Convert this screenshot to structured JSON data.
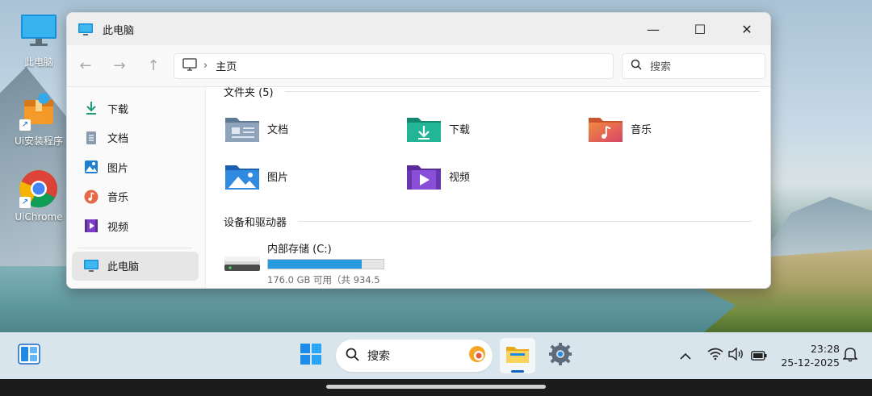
{
  "desktop": {
    "icons": [
      {
        "label": "此电脑"
      },
      {
        "label": "Ui安装程序"
      },
      {
        "label": "UiChrome"
      }
    ]
  },
  "window": {
    "title": "此电脑",
    "controls": {
      "minimize": "—",
      "maximize": "☐",
      "close": "✕"
    },
    "address": {
      "location": "主页",
      "separator": "›"
    },
    "search_placeholder": "搜索",
    "sidebar": {
      "items": [
        {
          "label": "下载",
          "icon": "download-icon"
        },
        {
          "label": "文档",
          "icon": "document-icon"
        },
        {
          "label": "图片",
          "icon": "pictures-icon"
        },
        {
          "label": "音乐",
          "icon": "music-icon"
        },
        {
          "label": "视频",
          "icon": "video-icon"
        }
      ],
      "active_item": {
        "label": "此电脑",
        "icon": "computer-icon"
      }
    },
    "folders_section": {
      "title": "文件夹 (5)"
    },
    "folders": [
      {
        "label": "文档",
        "color": "#7a8fa6"
      },
      {
        "label": "下载",
        "color": "#1fa58a"
      },
      {
        "label": "音乐",
        "color": "#e46a4a"
      },
      {
        "label": "图片",
        "color": "#2a7fd4"
      },
      {
        "label": "视频",
        "color": "#7a3fc4"
      }
    ],
    "drives_section": {
      "title": "设备和驱动器"
    },
    "drive": {
      "name": "内部存储 (C:)",
      "free_text": "176.0 GB 可用（共 934.5",
      "used_fraction": 0.81,
      "bar_color": "#2a9ae0"
    }
  },
  "taskbar": {
    "search_label": "搜索",
    "time": "23:28",
    "date": "25-12-2025"
  }
}
